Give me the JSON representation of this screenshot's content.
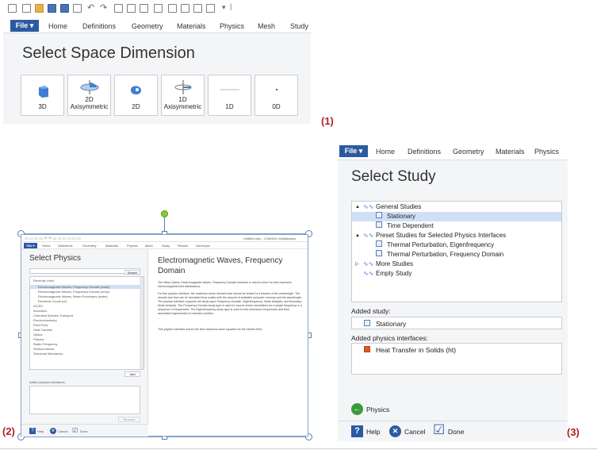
{
  "panel1": {
    "file_label": "File ▾",
    "tabs": [
      "Home",
      "Definitions",
      "Geometry",
      "Materials",
      "Physics",
      "Mesh",
      "Study"
    ],
    "title": "Select Space Dimension",
    "buttons": [
      "3D",
      "2D\nAxisymmetric",
      "2D",
      "1D\nAxisymmetric",
      "1D",
      "0D"
    ],
    "caption": "(1)"
  },
  "panel2": {
    "window_title": "Untitled.mph - COMSOL Multiphysics",
    "file_label": "File ▾",
    "tabs": [
      "Home",
      "Definitions",
      "Geometry",
      "Materials",
      "Physics",
      "Mesh",
      "Study",
      "Results",
      "Developer"
    ],
    "title": "Select Physics",
    "search_button": "Search",
    "tree": [
      "Recently Used",
      "Electromagnetic Waves, Frequency Domain (ewfd)",
      "Electromagnetic Waves, Frequency Domain (emw)",
      "Electromagnetic Waves, Beam Envelopes (ewbe)",
      "Electrical Circuit (cir)",
      "AC/DC",
      "Acoustics",
      "Chemical Species Transport",
      "Electrochemistry",
      "Fluid Flow",
      "Heat Transfer",
      "Optics",
      "Plasma",
      "Radio Frequency",
      "Semiconductor",
      "Structural Mechanics"
    ],
    "add_button": "Add",
    "added_label": "Added physics interfaces:",
    "remove_button": "Remove",
    "back_label": "Space Dimension",
    "next_label": "Study",
    "help": "Help",
    "cancel": "Cancel",
    "done": "Done",
    "detail_title": "Electromagnetic Waves, Frequency Domain",
    "detail_paragraphs": [
      "The Wave Optics, Electromagnetic Waves, Frequency Domain interface is used to solve for time-harmonic electromagnetic field distributions.",
      "For this physics interface, the maximum mesh element size should be limited to a fraction of the wavelength. The domain size that can be simulated thus scales with the amount of available computer memory and the wavelength. The physics interface supports the study types Frequency Domain, Eigenfrequency, Mode Analysis, and Boundary Mode Analysis. The Frequency Domain study type is used for source driven simulations for a single frequency or a sequence of frequencies. The Eigenfrequency study type is used to find resonance frequencies and their associated eigenmodes in resonant cavities.",
      "This physics interface solves the time-harmonic wave equation for the electric field."
    ],
    "caption": "(2)"
  },
  "panel3": {
    "file_label": "File ▾",
    "tabs": [
      "Home",
      "Definitions",
      "Geometry",
      "Materials",
      "Physics"
    ],
    "title": "Select Study",
    "tree": [
      {
        "label": "General Studies",
        "level": 0,
        "toggle": "▲"
      },
      {
        "label": "Stationary",
        "level": 1,
        "selected": true
      },
      {
        "label": "Time Dependent",
        "level": 1
      },
      {
        "label": "Preset Studies for Selected Physics Interfaces",
        "level": 0,
        "toggle": "▲"
      },
      {
        "label": "Thermal Perturbation, Eigenfrequency",
        "level": 1
      },
      {
        "label": "Thermal Perturbation, Frequency Domain",
        "level": 1
      },
      {
        "label": "More Studies",
        "level": 0,
        "toggle": "▷"
      },
      {
        "label": "Empty Study",
        "level": 0
      }
    ],
    "added_study_label": "Added study:",
    "added_study": "Stationary",
    "added_physics_label": "Added physics interfaces:",
    "added_physics": "Heat Transfer in Solids (ht)",
    "back_label": "Physics",
    "help": "Help",
    "cancel": "Cancel",
    "done": "Done",
    "caption": "(3)"
  },
  "colors": {
    "accent": "#2c5aa0",
    "selection": "#cfe0f5",
    "caption": "#b02020"
  }
}
